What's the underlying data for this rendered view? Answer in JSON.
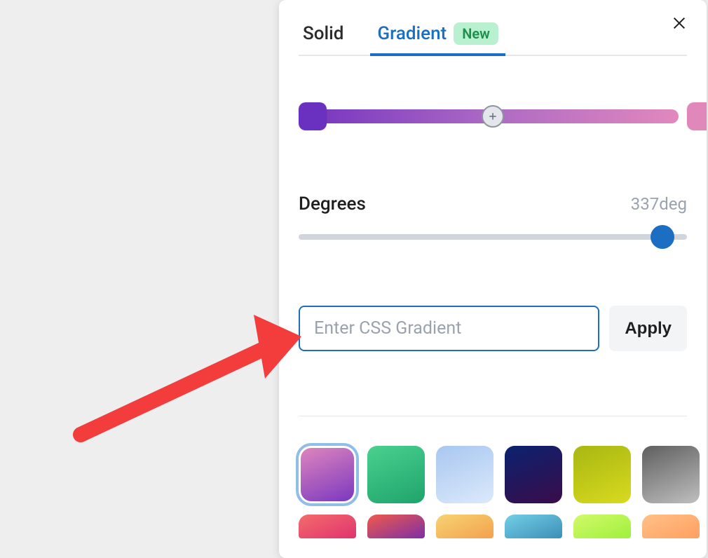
{
  "tabs": {
    "solid": "Solid",
    "gradient": "Gradient",
    "badge": "New"
  },
  "gradient_bar": {
    "start_color": "#6a31c0",
    "end_color": "#e088ba"
  },
  "degrees": {
    "label": "Degrees",
    "value": "337deg",
    "slider_percent": 93.6
  },
  "css_input": {
    "placeholder": "Enter CSS Gradient",
    "value": ""
  },
  "apply_label": "Apply",
  "swatches_row1": [
    {
      "css": "linear-gradient(337deg,#7735c0 0%,#e288bd 100%)",
      "selected": true
    },
    {
      "css": "linear-gradient(337deg,#1fa36b 0%,#4ad18f 100%)"
    },
    {
      "css": "linear-gradient(337deg,#dce9fb 0%,#a8c7f0 100%)"
    },
    {
      "css": "linear-gradient(337deg,#3a0c4a 0%,#0b2270 100%)"
    },
    {
      "css": "linear-gradient(337deg,#d8da1f 0%,#a8b712 100%)"
    },
    {
      "css": "linear-gradient(337deg,#bfbfbf 0%,#5f5f5f 100%)"
    }
  ],
  "swatches_row2": [
    {
      "css": "linear-gradient(337deg,#e0336e 0%,#f46c6c 100%)"
    },
    {
      "css": "linear-gradient(337deg,#7d2fa6 0%,#f05a4a 100%)"
    },
    {
      "css": "linear-gradient(337deg,#f3a14e 0%,#f7d373 100%)"
    },
    {
      "css": "linear-gradient(337deg,#3b8fb8 0%,#73cfe6 100%)"
    },
    {
      "css": "linear-gradient(337deg,#9ff03c 0%,#d2f96a 100%)"
    },
    {
      "css": "linear-gradient(337deg,#ff9f60 0%,#ffc188 100%)"
    }
  ],
  "colors": {
    "accent": "#1b6ec2",
    "badge_bg": "#b9f0cf",
    "badge_text": "#1c8f4d",
    "arrow": "#f33c3c"
  }
}
